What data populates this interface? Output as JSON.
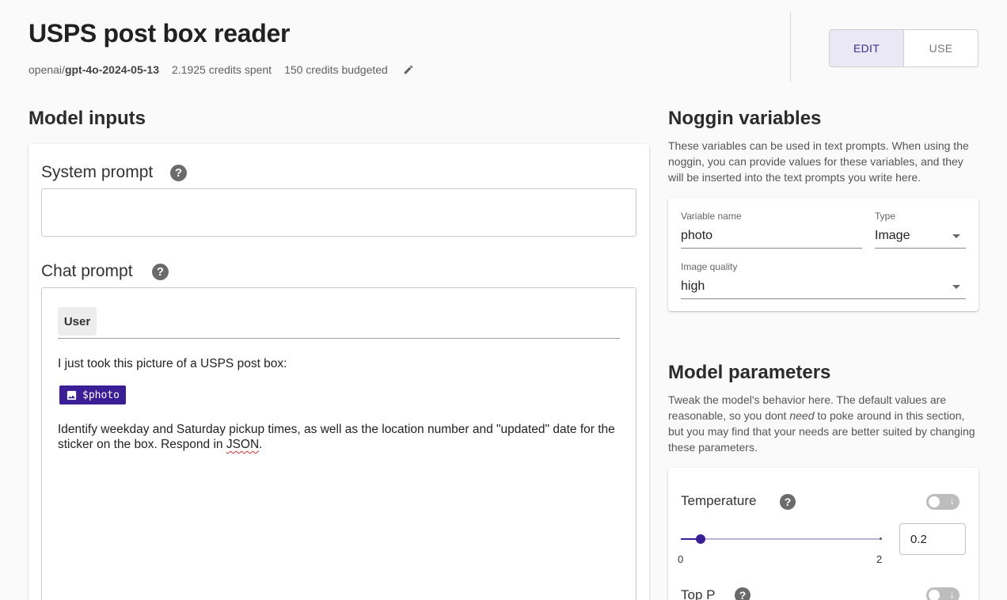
{
  "header": {
    "title": "USPS post box reader",
    "model_prefix": "openai/",
    "model_name": "gpt-4o-2024-05-13",
    "credits_spent": "2.1925 credits spent",
    "credits_budgeted": "150 credits budgeted",
    "edit_icon": "pencil-icon"
  },
  "mode_toggle": {
    "edit_label": "EDIT",
    "use_label": "USE",
    "active": "EDIT"
  },
  "model_inputs": {
    "title": "Model inputs",
    "system_prompt": {
      "label": "System prompt",
      "help": "?",
      "value": ""
    },
    "chat_prompt": {
      "label": "Chat prompt",
      "help": "?",
      "role": "User",
      "line1": "I just took this picture of a USPS post box:",
      "variable_chip": "$photo",
      "variable_icon": "image-icon",
      "line2_part1": "Identify weekday and Saturday pickup times, as well as the location number and \"updated\" date for the",
      "line2_part2_prefix": "sticker on the box. Respond in ",
      "line2_misspelled": "JSON",
      "line2_suffix": "."
    }
  },
  "noggin_variables": {
    "title": "Noggin variables",
    "description": "These variables can be used in text prompts. When using the noggin, you can provide values for these variables, and they will be inserted into the text prompts you write here.",
    "variable": {
      "name_label": "Variable name",
      "name_value": "photo",
      "type_label": "Type",
      "type_value": "Image",
      "quality_label": "Image quality",
      "quality_value": "high"
    }
  },
  "model_parameters": {
    "title": "Model parameters",
    "description_part1": "Tweak the model's behavior here. The default values are reasonable, so you dont ",
    "description_emphasis": "need",
    "description_part2": " to poke around in this section, but you may find that your needs are better suited by changing these parameters.",
    "temperature": {
      "label": "Temperature",
      "help": "?",
      "toggle_arrow": "↓",
      "enabled": false,
      "min_label": "0",
      "max_label": "2",
      "min": 0,
      "max": 2,
      "value": 0.2,
      "value_text": "0.2"
    },
    "top_p": {
      "label": "Top P",
      "help": "?",
      "toggle_arrow": "↓",
      "enabled": false
    }
  }
}
